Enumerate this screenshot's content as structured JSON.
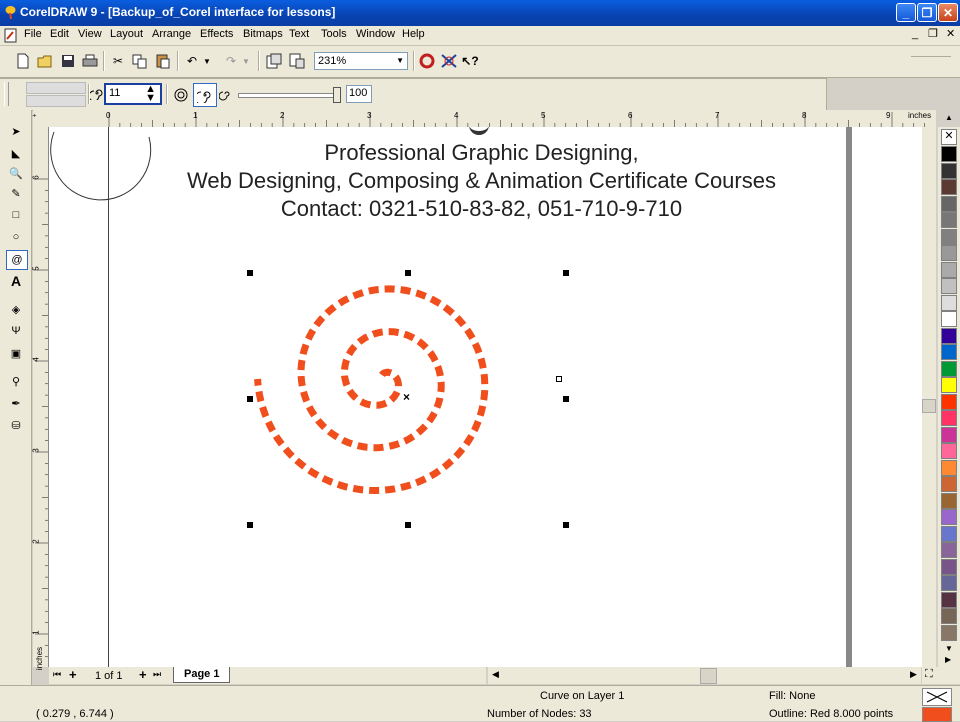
{
  "window": {
    "title": "CorelDRAW 9 - [Backup_of_Corel interface for lessons]"
  },
  "menu": [
    "File",
    "Edit",
    "View",
    "Layout",
    "Arrange",
    "Effects",
    "Bitmaps",
    "Text",
    "Tools",
    "Window",
    "Help"
  ],
  "toolbar": {
    "zoom": "231%"
  },
  "property_bar": {
    "revolutions": "11",
    "expansion": "100"
  },
  "ruler": {
    "unit": "inches",
    "top_ticks": [
      "0",
      "1",
      "2",
      "3",
      "4",
      "5",
      "6",
      "7",
      "8",
      "9"
    ],
    "left_ticks": [
      "6",
      "5",
      "4",
      "3",
      "2",
      "1"
    ]
  },
  "canvas": {
    "line1": "Professional Graphic Designing,",
    "line2": "Web Designing, Composing & Animation Certificate Courses",
    "line3": "Contact: 0321-510-83-82, 051-710-9-710"
  },
  "pages": {
    "count": "1 of 1",
    "tab": "Page 1"
  },
  "status": {
    "coords": "( 0.279 , 6.744 )",
    "object": "Curve on Layer 1",
    "nodes": "Number of Nodes: 33",
    "fill": "Fill: None",
    "outline": "Outline: Red  8.000 points"
  },
  "colors": {
    "spiral": "#f04e1c",
    "palette": [
      "#000000",
      "#333333",
      "#5a3a32",
      "#666666",
      "#777777",
      "#808080",
      "#999999",
      "#aaaaaa",
      "#c0c0c0",
      "#dddddd",
      "#ffffff",
      "#330099",
      "#0066cc",
      "#009933",
      "#ffff00",
      "#ff3300",
      "#ff3366",
      "#cc3399",
      "#ff6699",
      "#ff8833",
      "#cc6633",
      "#996633",
      "#9966cc",
      "#6677cc",
      "#886699",
      "#775588",
      "#666699",
      "#553344",
      "#776655",
      "#887766"
    ]
  }
}
